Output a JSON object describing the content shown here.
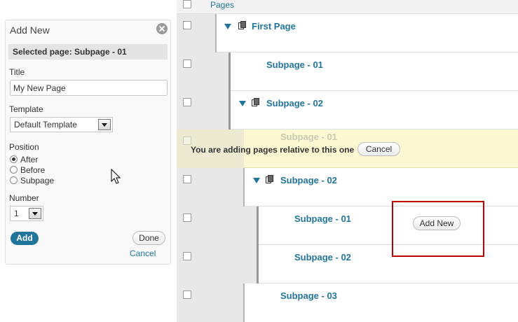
{
  "panel": {
    "title": "Add New",
    "selected_page": "Selected page: Subpage - 01",
    "title_label": "Title",
    "title_value": "My New Page",
    "template_label": "Template",
    "template_value": "Default Template",
    "position_label": "Position",
    "position_options": [
      "After",
      "Before",
      "Subpage"
    ],
    "position_selected": "After",
    "number_label": "Number",
    "number_value": "1",
    "add_button": "Add",
    "done_button": "Done",
    "cancel_link": "Cancel"
  },
  "list": {
    "header": "Pages",
    "rows": [
      {
        "title": "First Page"
      },
      {
        "title": "Subpage - 01"
      },
      {
        "title": "Subpage - 02"
      },
      {
        "title": "Subpage - 01"
      },
      {
        "title": "Subpage - 02"
      },
      {
        "title": "Subpage - 01"
      },
      {
        "title": "Subpage - 02"
      },
      {
        "title": "Subpage - 03"
      }
    ],
    "notice_text": "You are adding pages relative to this one",
    "notice_cancel": "Cancel",
    "add_new_button": "Add New"
  },
  "colors": {
    "link": "#21759b",
    "notice_bg": "#fbf8d2",
    "highlight": "#c00000"
  }
}
